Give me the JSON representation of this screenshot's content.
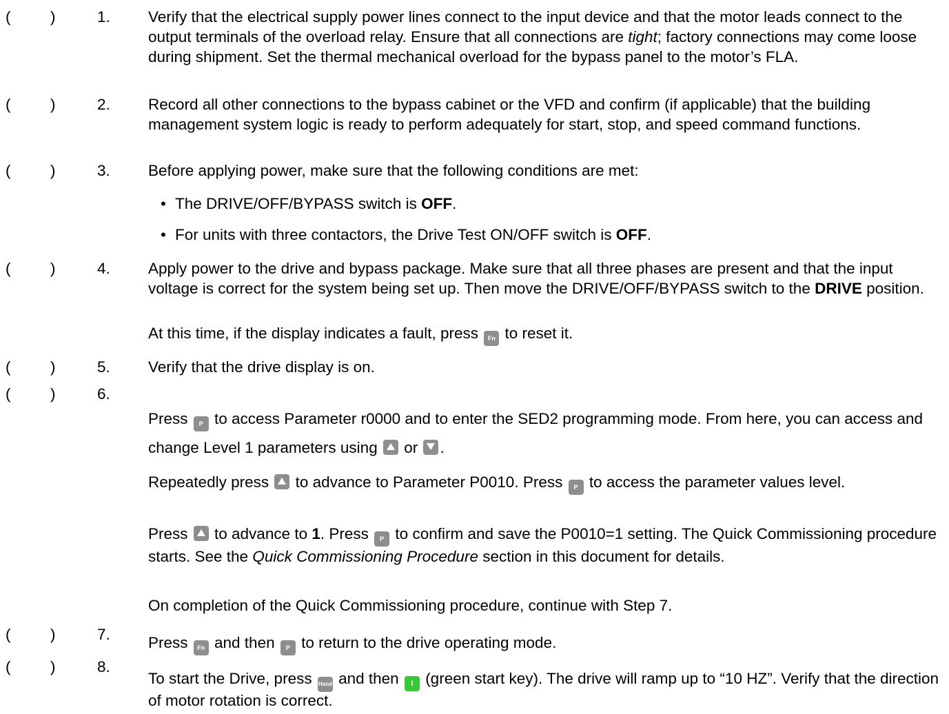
{
  "checkbox": {
    "open": "(",
    "close": ")"
  },
  "bullet_glyph": "•",
  "keys": {
    "fn": "Fn",
    "p": "P",
    "hand": "Hand",
    "start": "I",
    "up": "up-arrow-icon",
    "down": "down-arrow-icon"
  },
  "colors": {
    "key_gray": "#8e8e8e",
    "key_green": "#37c837"
  },
  "steps": [
    {
      "num": "1.",
      "p1": "Verify that the electrical supply power lines connect to the input device and that the motor leads connect to the output terminals of the overload relay. Ensure that all connections are ",
      "p1_i": "tight",
      "p1_b": "; factory connections may come loose during shipment. Set the thermal mechanical overload for the bypass panel to the motor’s FLA."
    },
    {
      "num": "2.",
      "p1": "Record all other connections to the bypass cabinet or the VFD and confirm (if applicable) that the building management system logic is ready to perform adequately for start, stop, and speed command functions."
    },
    {
      "num": "3.",
      "p1": "Before applying power, make sure that the following conditions are met:",
      "b1a": "The DRIVE/OFF/BYPASS switch is ",
      "b1b": "OFF",
      "b1c": ".",
      "b2a": "For units with three contactors, the Drive Test ON/OFF switch is ",
      "b2b": "OFF",
      "b2c": "."
    },
    {
      "num": "4.",
      "p1": "Apply power to the drive and bypass package. Make sure that all three phases are present and that the input voltage is correct for the system being set up. Then move the DRIVE/OFF/BYPASS switch to the ",
      "p1_b": "DRIVE",
      "p1_c": " position.",
      "p2a": "At this time, if the display indicates a fault, press ",
      "p2b": " to reset it."
    },
    {
      "num": "5.",
      "p1": "Verify that the drive display is on."
    },
    {
      "num": "6.",
      "p1a": "Press ",
      "p1b": " to access Parameter r0000 and to enter the SED2 programming mode. From here, you can access and change Level 1 parameters using ",
      "p1c": " or ",
      "p1d": ".",
      "p2a": "Repeatedly press ",
      "p2b": " to advance to Parameter P0010. Press ",
      "p2c": " to access the parameter values level.",
      "p3a": "Press ",
      "p3b": " to advance to ",
      "p3c": "1",
      "p3d": ". Press ",
      "p3e": " to confirm and save the P0010=1 setting. The Quick Commissioning procedure starts. See the ",
      "p3f": "Quick Commissioning Procedure",
      "p3g": " section in this document for details.",
      "p4": "On completion of the Quick Commissioning procedure, continue with Step 7."
    },
    {
      "num": "7.",
      "p1a": "Press ",
      "p1b": " and then ",
      "p1c": " to return to the drive operating mode."
    },
    {
      "num": "8.",
      "p1a": "To start the Drive, press ",
      "p1b": " and then ",
      "p1c": " (green start key). The drive will ramp up to “10 HZ”. Verify that the direction of motor rotation is correct."
    }
  ]
}
